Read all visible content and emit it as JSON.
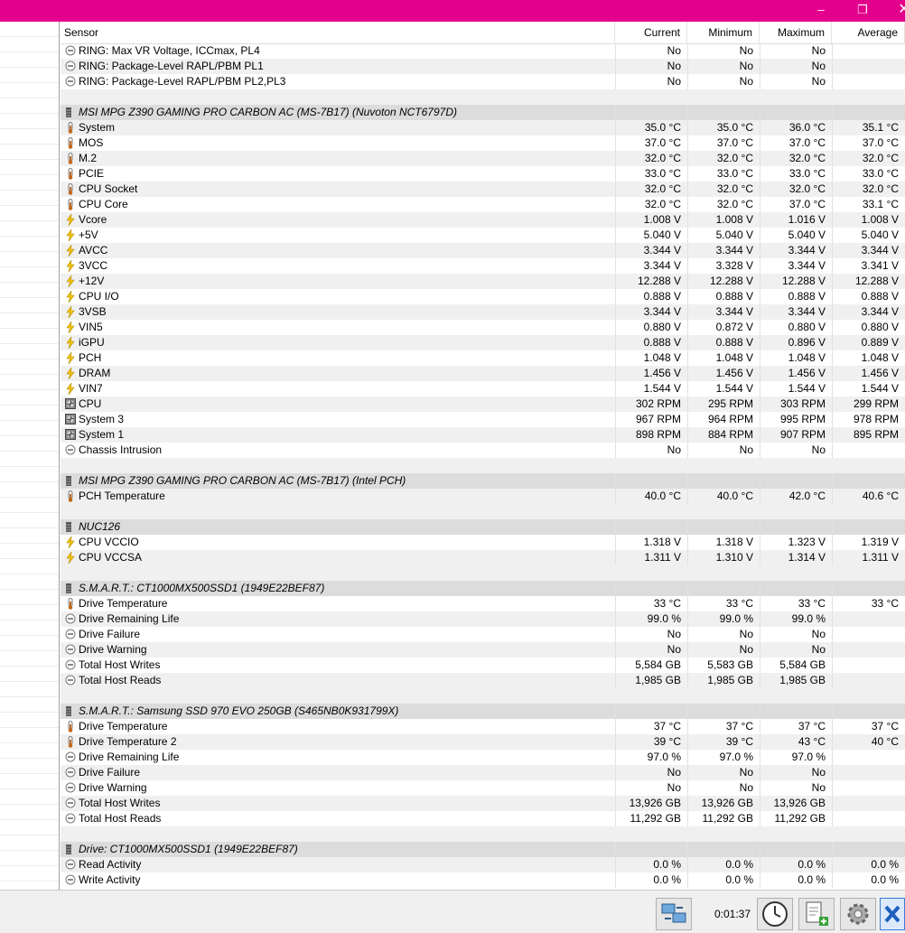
{
  "window": {
    "minimize": "–",
    "maximize": "❐",
    "close": "✕"
  },
  "headers": {
    "sensor": "Sensor",
    "current": "Current",
    "minimum": "Minimum",
    "maximum": "Maximum",
    "average": "Average"
  },
  "rows": [
    {
      "type": "item",
      "icon": "minus",
      "name": "RING: Max VR Voltage, ICCmax, PL4",
      "cur": "No",
      "min": "No",
      "max": "No",
      "avg": ""
    },
    {
      "type": "item",
      "icon": "minus",
      "name": "RING: Package-Level RAPL/PBM PL1",
      "cur": "No",
      "min": "No",
      "max": "No",
      "avg": ""
    },
    {
      "type": "item",
      "icon": "minus",
      "name": "RING: Package-Level RAPL/PBM PL2,PL3",
      "cur": "No",
      "min": "No",
      "max": "No",
      "avg": ""
    },
    {
      "type": "blank"
    },
    {
      "type": "group",
      "name": "MSI MPG Z390 GAMING PRO CARBON AC (MS-7B17) (Nuvoton NCT6797D)"
    },
    {
      "type": "item",
      "icon": "temp",
      "name": "System",
      "cur": "35.0 °C",
      "min": "35.0 °C",
      "max": "36.0 °C",
      "avg": "35.1 °C"
    },
    {
      "type": "item",
      "icon": "temp",
      "name": "MOS",
      "cur": "37.0 °C",
      "min": "37.0 °C",
      "max": "37.0 °C",
      "avg": "37.0 °C"
    },
    {
      "type": "item",
      "icon": "temp",
      "name": "M.2",
      "cur": "32.0 °C",
      "min": "32.0 °C",
      "max": "32.0 °C",
      "avg": "32.0 °C"
    },
    {
      "type": "item",
      "icon": "temp",
      "name": "PCIE",
      "cur": "33.0 °C",
      "min": "33.0 °C",
      "max": "33.0 °C",
      "avg": "33.0 °C"
    },
    {
      "type": "item",
      "icon": "temp",
      "name": "CPU Socket",
      "cur": "32.0 °C",
      "min": "32.0 °C",
      "max": "32.0 °C",
      "avg": "32.0 °C"
    },
    {
      "type": "item",
      "icon": "temp",
      "name": "CPU Core",
      "cur": "32.0 °C",
      "min": "32.0 °C",
      "max": "37.0 °C",
      "avg": "33.1 °C"
    },
    {
      "type": "item",
      "icon": "volt",
      "name": "Vcore",
      "cur": "1.008 V",
      "min": "1.008 V",
      "max": "1.016 V",
      "avg": "1.008 V"
    },
    {
      "type": "item",
      "icon": "volt",
      "name": "+5V",
      "cur": "5.040 V",
      "min": "5.040 V",
      "max": "5.040 V",
      "avg": "5.040 V"
    },
    {
      "type": "item",
      "icon": "volt",
      "name": "AVCC",
      "cur": "3.344 V",
      "min": "3.344 V",
      "max": "3.344 V",
      "avg": "3.344 V"
    },
    {
      "type": "item",
      "icon": "volt",
      "name": "3VCC",
      "cur": "3.344 V",
      "min": "3.328 V",
      "max": "3.344 V",
      "avg": "3.341 V"
    },
    {
      "type": "item",
      "icon": "volt",
      "name": "+12V",
      "cur": "12.288 V",
      "min": "12.288 V",
      "max": "12.288 V",
      "avg": "12.288 V"
    },
    {
      "type": "item",
      "icon": "volt",
      "name": "CPU I/O",
      "cur": "0.888 V",
      "min": "0.888 V",
      "max": "0.888 V",
      "avg": "0.888 V"
    },
    {
      "type": "item",
      "icon": "volt",
      "name": "3VSB",
      "cur": "3.344 V",
      "min": "3.344 V",
      "max": "3.344 V",
      "avg": "3.344 V"
    },
    {
      "type": "item",
      "icon": "volt",
      "name": "VIN5",
      "cur": "0.880 V",
      "min": "0.872 V",
      "max": "0.880 V",
      "avg": "0.880 V"
    },
    {
      "type": "item",
      "icon": "volt",
      "name": "iGPU",
      "cur": "0.888 V",
      "min": "0.888 V",
      "max": "0.896 V",
      "avg": "0.889 V"
    },
    {
      "type": "item",
      "icon": "volt",
      "name": "PCH",
      "cur": "1.048 V",
      "min": "1.048 V",
      "max": "1.048 V",
      "avg": "1.048 V"
    },
    {
      "type": "item",
      "icon": "volt",
      "name": "DRAM",
      "cur": "1.456 V",
      "min": "1.456 V",
      "max": "1.456 V",
      "avg": "1.456 V"
    },
    {
      "type": "item",
      "icon": "volt",
      "name": "VIN7",
      "cur": "1.544 V",
      "min": "1.544 V",
      "max": "1.544 V",
      "avg": "1.544 V"
    },
    {
      "type": "item",
      "icon": "fan",
      "name": "CPU",
      "cur": "302 RPM",
      "min": "295 RPM",
      "max": "303 RPM",
      "avg": "299 RPM"
    },
    {
      "type": "item",
      "icon": "fan",
      "name": "System 3",
      "cur": "967 RPM",
      "min": "964 RPM",
      "max": "995 RPM",
      "avg": "978 RPM"
    },
    {
      "type": "item",
      "icon": "fan",
      "name": "System 1",
      "cur": "898 RPM",
      "min": "884 RPM",
      "max": "907 RPM",
      "avg": "895 RPM"
    },
    {
      "type": "item",
      "icon": "minus",
      "name": "Chassis Intrusion",
      "cur": "No",
      "min": "No",
      "max": "No",
      "avg": ""
    },
    {
      "type": "blank"
    },
    {
      "type": "group",
      "name": "MSI MPG Z390 GAMING PRO CARBON AC (MS-7B17) (Intel PCH)"
    },
    {
      "type": "item",
      "icon": "temp",
      "name": "PCH Temperature",
      "cur": "40.0 °C",
      "min": "40.0 °C",
      "max": "42.0 °C",
      "avg": "40.6 °C"
    },
    {
      "type": "blank"
    },
    {
      "type": "group",
      "name": "NUC126"
    },
    {
      "type": "item",
      "icon": "volt",
      "name": "CPU VCCIO",
      "cur": "1.318 V",
      "min": "1.318 V",
      "max": "1.323 V",
      "avg": "1.319 V"
    },
    {
      "type": "item",
      "icon": "volt",
      "name": "CPU VCCSA",
      "cur": "1.311 V",
      "min": "1.310 V",
      "max": "1.314 V",
      "avg": "1.311 V"
    },
    {
      "type": "blank"
    },
    {
      "type": "group",
      "name": "S.M.A.R.T.: CT1000MX500SSD1 (1949E22BEF87)"
    },
    {
      "type": "item",
      "icon": "temp",
      "name": "Drive Temperature",
      "cur": "33 °C",
      "min": "33 °C",
      "max": "33 °C",
      "avg": "33 °C"
    },
    {
      "type": "item",
      "icon": "minus",
      "name": "Drive Remaining Life",
      "cur": "99.0 %",
      "min": "99.0 %",
      "max": "99.0 %",
      "avg": ""
    },
    {
      "type": "item",
      "icon": "minus",
      "name": "Drive Failure",
      "cur": "No",
      "min": "No",
      "max": "No",
      "avg": ""
    },
    {
      "type": "item",
      "icon": "minus",
      "name": "Drive Warning",
      "cur": "No",
      "min": "No",
      "max": "No",
      "avg": ""
    },
    {
      "type": "item",
      "icon": "minus",
      "name": "Total Host Writes",
      "cur": "5,584 GB",
      "min": "5,583 GB",
      "max": "5,584 GB",
      "avg": ""
    },
    {
      "type": "item",
      "icon": "minus",
      "name": "Total Host Reads",
      "cur": "1,985 GB",
      "min": "1,985 GB",
      "max": "1,985 GB",
      "avg": ""
    },
    {
      "type": "blank"
    },
    {
      "type": "group",
      "name": "S.M.A.R.T.: Samsung SSD 970 EVO 250GB (S465NB0K931799X)"
    },
    {
      "type": "item",
      "icon": "temp",
      "name": "Drive Temperature",
      "cur": "37 °C",
      "min": "37 °C",
      "max": "37 °C",
      "avg": "37 °C"
    },
    {
      "type": "item",
      "icon": "temp",
      "name": "Drive Temperature 2",
      "cur": "39 °C",
      "min": "39 °C",
      "max": "43 °C",
      "avg": "40 °C"
    },
    {
      "type": "item",
      "icon": "minus",
      "name": "Drive Remaining Life",
      "cur": "97.0 %",
      "min": "97.0 %",
      "max": "97.0 %",
      "avg": ""
    },
    {
      "type": "item",
      "icon": "minus",
      "name": "Drive Failure",
      "cur": "No",
      "min": "No",
      "max": "No",
      "avg": ""
    },
    {
      "type": "item",
      "icon": "minus",
      "name": "Drive Warning",
      "cur": "No",
      "min": "No",
      "max": "No",
      "avg": ""
    },
    {
      "type": "item",
      "icon": "minus",
      "name": "Total Host Writes",
      "cur": "13,926 GB",
      "min": "13,926 GB",
      "max": "13,926 GB",
      "avg": ""
    },
    {
      "type": "item",
      "icon": "minus",
      "name": "Total Host Reads",
      "cur": "11,292 GB",
      "min": "11,292 GB",
      "max": "11,292 GB",
      "avg": ""
    },
    {
      "type": "blank"
    },
    {
      "type": "group",
      "name": "Drive: CT1000MX500SSD1 (1949E22BEF87)"
    },
    {
      "type": "item",
      "icon": "minus",
      "name": "Read Activity",
      "cur": "0.0 %",
      "min": "0.0 %",
      "max": "0.0 %",
      "avg": "0.0 %"
    },
    {
      "type": "item",
      "icon": "minus",
      "name": "Write Activity",
      "cur": "0.0 %",
      "min": "0.0 %",
      "max": "0.0 %",
      "avg": "0.0 %"
    }
  ],
  "statusbar": {
    "elapsed": "0:01:37"
  },
  "colors": {
    "titlebar": "#e3008c",
    "group_bg": "#dcdcdc",
    "alt_row": "#f0f0f0",
    "volt_icon": "#f5c400",
    "temp_icon": "#c46a1e"
  }
}
